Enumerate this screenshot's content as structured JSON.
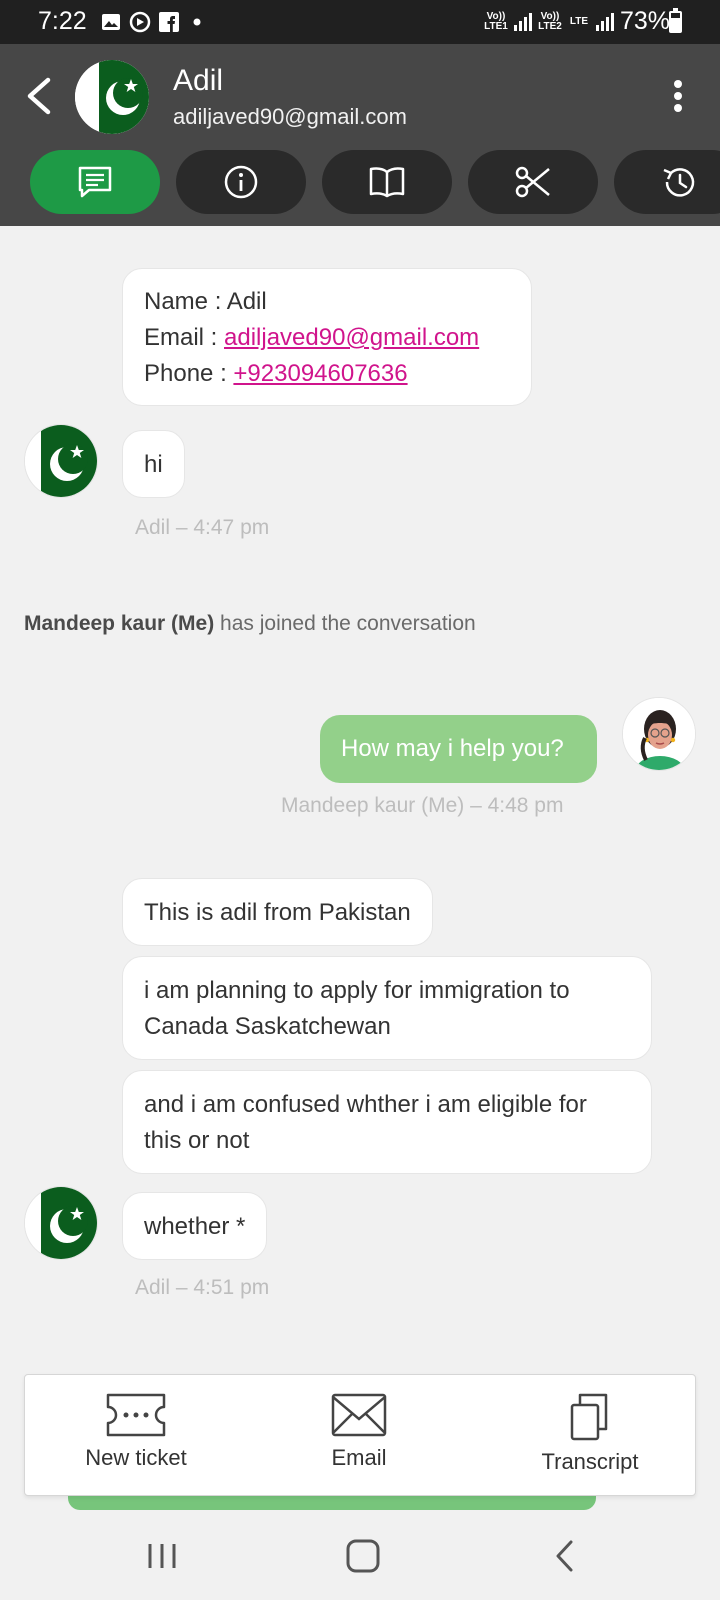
{
  "status_bar": {
    "time": "7:22",
    "lte1": "Vo)) LTE1",
    "lte2": "Vo)) LTE2",
    "lte": "LTE",
    "battery": "73%"
  },
  "header": {
    "contact_name": "Adil",
    "contact_email": "adiljaved90@gmail.com",
    "tabs": [
      {
        "icon": "chat-icon",
        "active": true
      },
      {
        "icon": "info-icon",
        "active": false
      },
      {
        "icon": "book-icon",
        "active": false
      },
      {
        "icon": "scissors-icon",
        "active": false
      },
      {
        "icon": "history-icon",
        "active": false
      }
    ]
  },
  "chat": {
    "info_card": {
      "name_label": "Name : ",
      "name_value": "Adil",
      "email_label": "Email : ",
      "email_value": "adiljaved90@gmail.com",
      "phone_label": "Phone : ",
      "phone_value": "+923094607636"
    },
    "msg_hi": "hi",
    "meta_1": "Adil – 4:47 pm",
    "system_name": "Mandeep kaur (Me)",
    "system_text": " has joined the conversation",
    "msg_help": "How may i help you?",
    "meta_2": "Mandeep kaur (Me) – 4:48 pm",
    "msg_pakistan": "This is adil from Pakistan",
    "msg_plan": "i am planning to apply for immigration to Canada Saskatchewan",
    "msg_confused": "and i am confused whther i am eligible for this or not",
    "msg_whether": "whether *",
    "meta_3": "Adil – 4:51 pm"
  },
  "actions": {
    "new_ticket": "New ticket",
    "email": "Email",
    "transcript": "Transcript"
  },
  "colors": {
    "header": "#474747",
    "active_tab": "#1e9a46",
    "my_bubble": "#93d08a",
    "link": "#d0148c",
    "flag_green": "#01411c"
  }
}
